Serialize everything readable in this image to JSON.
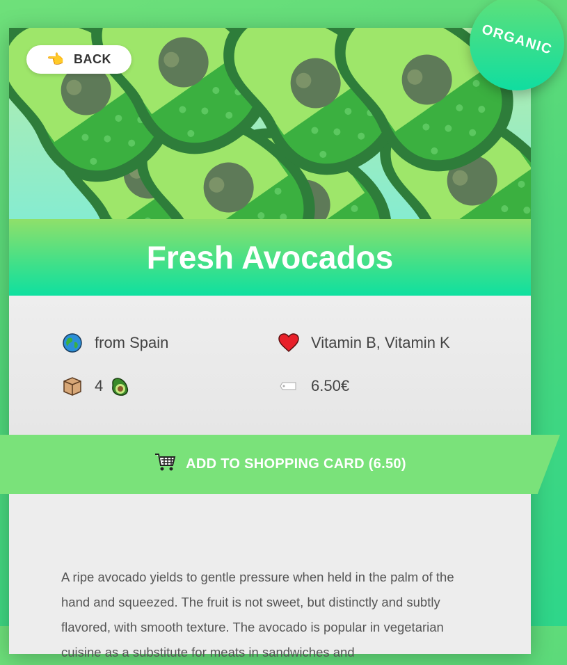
{
  "back": {
    "label": "BACK",
    "icon": "pointing-hand-icon"
  },
  "badge": {
    "label": "ORGANIC"
  },
  "product": {
    "title": "Fresh Avocados",
    "origin": "from Spain",
    "vitamins": "Vitamin B, Vitamin K",
    "quantity": "4",
    "price": "6.50€"
  },
  "cart": {
    "label": "ADD TO SHOPPING CARD (6.50)",
    "icon": "shopping-cart-icon"
  },
  "description": "A ripe avocado yields to gentle pressure when held in the palm of the hand and squeezed. The fruit is not sweet, but distinctly and subtly flavored, with smooth texture. The avocado is popular in vegetarian cuisine as a substitute for meats in sandwiches and",
  "colors": {
    "green": "#7ae27a",
    "teal": "#10dda0",
    "dark_green": "#2e8a3a"
  }
}
